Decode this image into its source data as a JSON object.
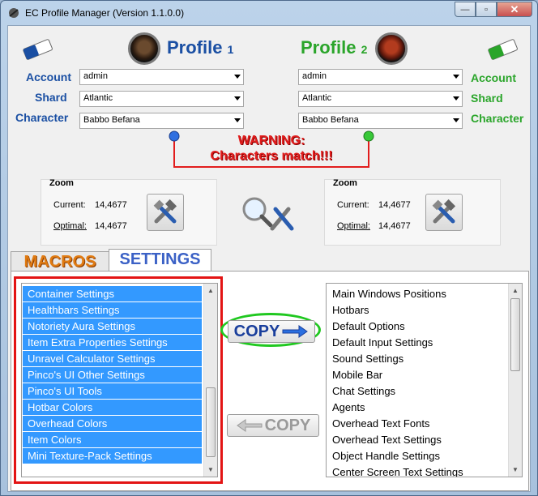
{
  "window": {
    "title": "EC Profile Manager (Version 1.1.0.0)"
  },
  "profiles": [
    {
      "title_word": "Profile",
      "title_num": "1",
      "account_label": "Account",
      "shard_label": "Shard",
      "character_label": "Character",
      "account": "admin",
      "shard": "Atlantic",
      "character": "Babbo Befana",
      "color": "#1a4fa3"
    },
    {
      "title_word": "Profile",
      "title_num": "2",
      "account_label": "Account",
      "shard_label": "Shard",
      "character_label": "Character",
      "account": "admin",
      "shard": "Atlantic",
      "character": "Babbo Befana",
      "color": "#2aa52a"
    }
  ],
  "warning": {
    "line1": "WARNING:",
    "line2": "Characters match!!!"
  },
  "zoom": [
    {
      "title": "Zoom",
      "current_label": "Current:",
      "current_value": "14,4677",
      "optimal_label": "Optimal:",
      "optimal_value": "14,4677"
    },
    {
      "title": "Zoom",
      "current_label": "Current:",
      "current_value": "14,4677",
      "optimal_label": "Optimal:",
      "optimal_value": "14,4677"
    }
  ],
  "tabs": {
    "macros": "MACROS",
    "settings": "SETTINGS"
  },
  "left_list": [
    "Container Settings",
    "Healthbars Settings",
    "Notoriety Aura Settings",
    "Item Extra Properties Settings",
    "Unravel Calculator Settings",
    "Pinco's UI Other Settings",
    "Pinco's UI Tools",
    "Hotbar Colors",
    "Overhead Colors",
    "Item Colors",
    "Mini Texture-Pack Settings"
  ],
  "right_list": [
    "Main Windows Positions",
    "Hotbars",
    "Default Options",
    "Default Input Settings",
    "Sound Settings",
    "Mobile Bar",
    "Chat Settings",
    "Agents",
    "Overhead Text Fonts",
    "Overhead Text Settings",
    "Object Handle Settings",
    "Center Screen Text Settings"
  ],
  "buttons": {
    "copy_right": "COPY",
    "copy_left": "COPY"
  },
  "colors": {
    "accent_blue": "#1a4fa3",
    "accent_green": "#2aa52a",
    "warning_red": "#e21d1d",
    "selection": "#3399ff"
  }
}
